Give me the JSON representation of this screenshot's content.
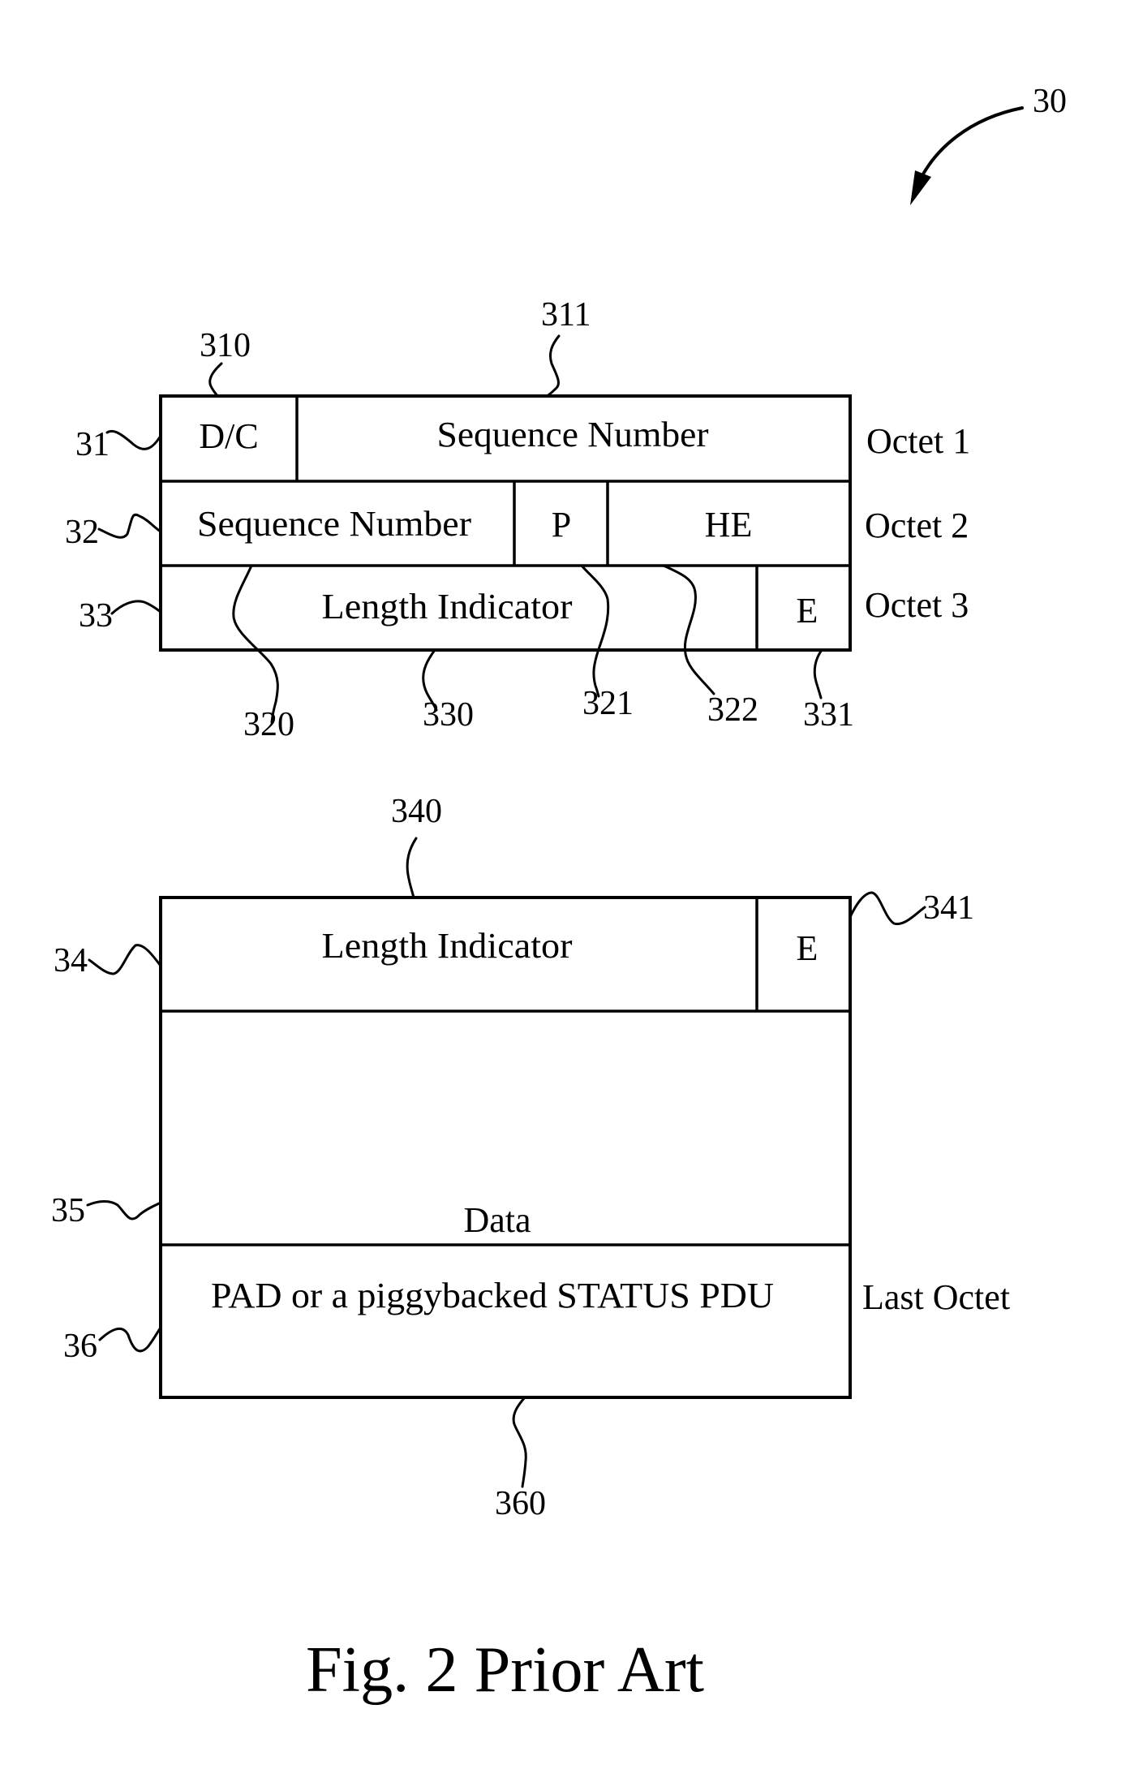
{
  "figure": {
    "ref": "30",
    "caption": "Fig. 2 Prior Art"
  },
  "header_block": {
    "rows": [
      {
        "ref": "31",
        "octet_label": "Octet 1",
        "fields": [
          {
            "ref": "310",
            "label": "D/C"
          },
          {
            "ref": "311",
            "label": "Sequence Number"
          }
        ]
      },
      {
        "ref": "32",
        "octet_label": "Octet 2",
        "fields": [
          {
            "ref": "320",
            "label": "Sequence Number"
          },
          {
            "ref": "321",
            "label": "P"
          },
          {
            "ref": "322",
            "label": "HE"
          }
        ]
      },
      {
        "ref": "33",
        "octet_label": "Octet 3",
        "fields": [
          {
            "ref": "330",
            "label": "Length Indicator"
          },
          {
            "ref": "331",
            "label": "E"
          }
        ]
      }
    ]
  },
  "payload_block": {
    "rows": [
      {
        "ref": "34",
        "fields": [
          {
            "ref": "340",
            "label": "Length Indicator"
          },
          {
            "ref": "341",
            "label": "E"
          }
        ]
      },
      {
        "ref": "35",
        "fields": [
          {
            "label": "Data"
          }
        ]
      },
      {
        "ref": "36",
        "octet_label": "Last Octet",
        "fields": [
          {
            "ref": "360",
            "label": "PAD or a piggybacked STATUS PDU"
          }
        ]
      }
    ]
  }
}
